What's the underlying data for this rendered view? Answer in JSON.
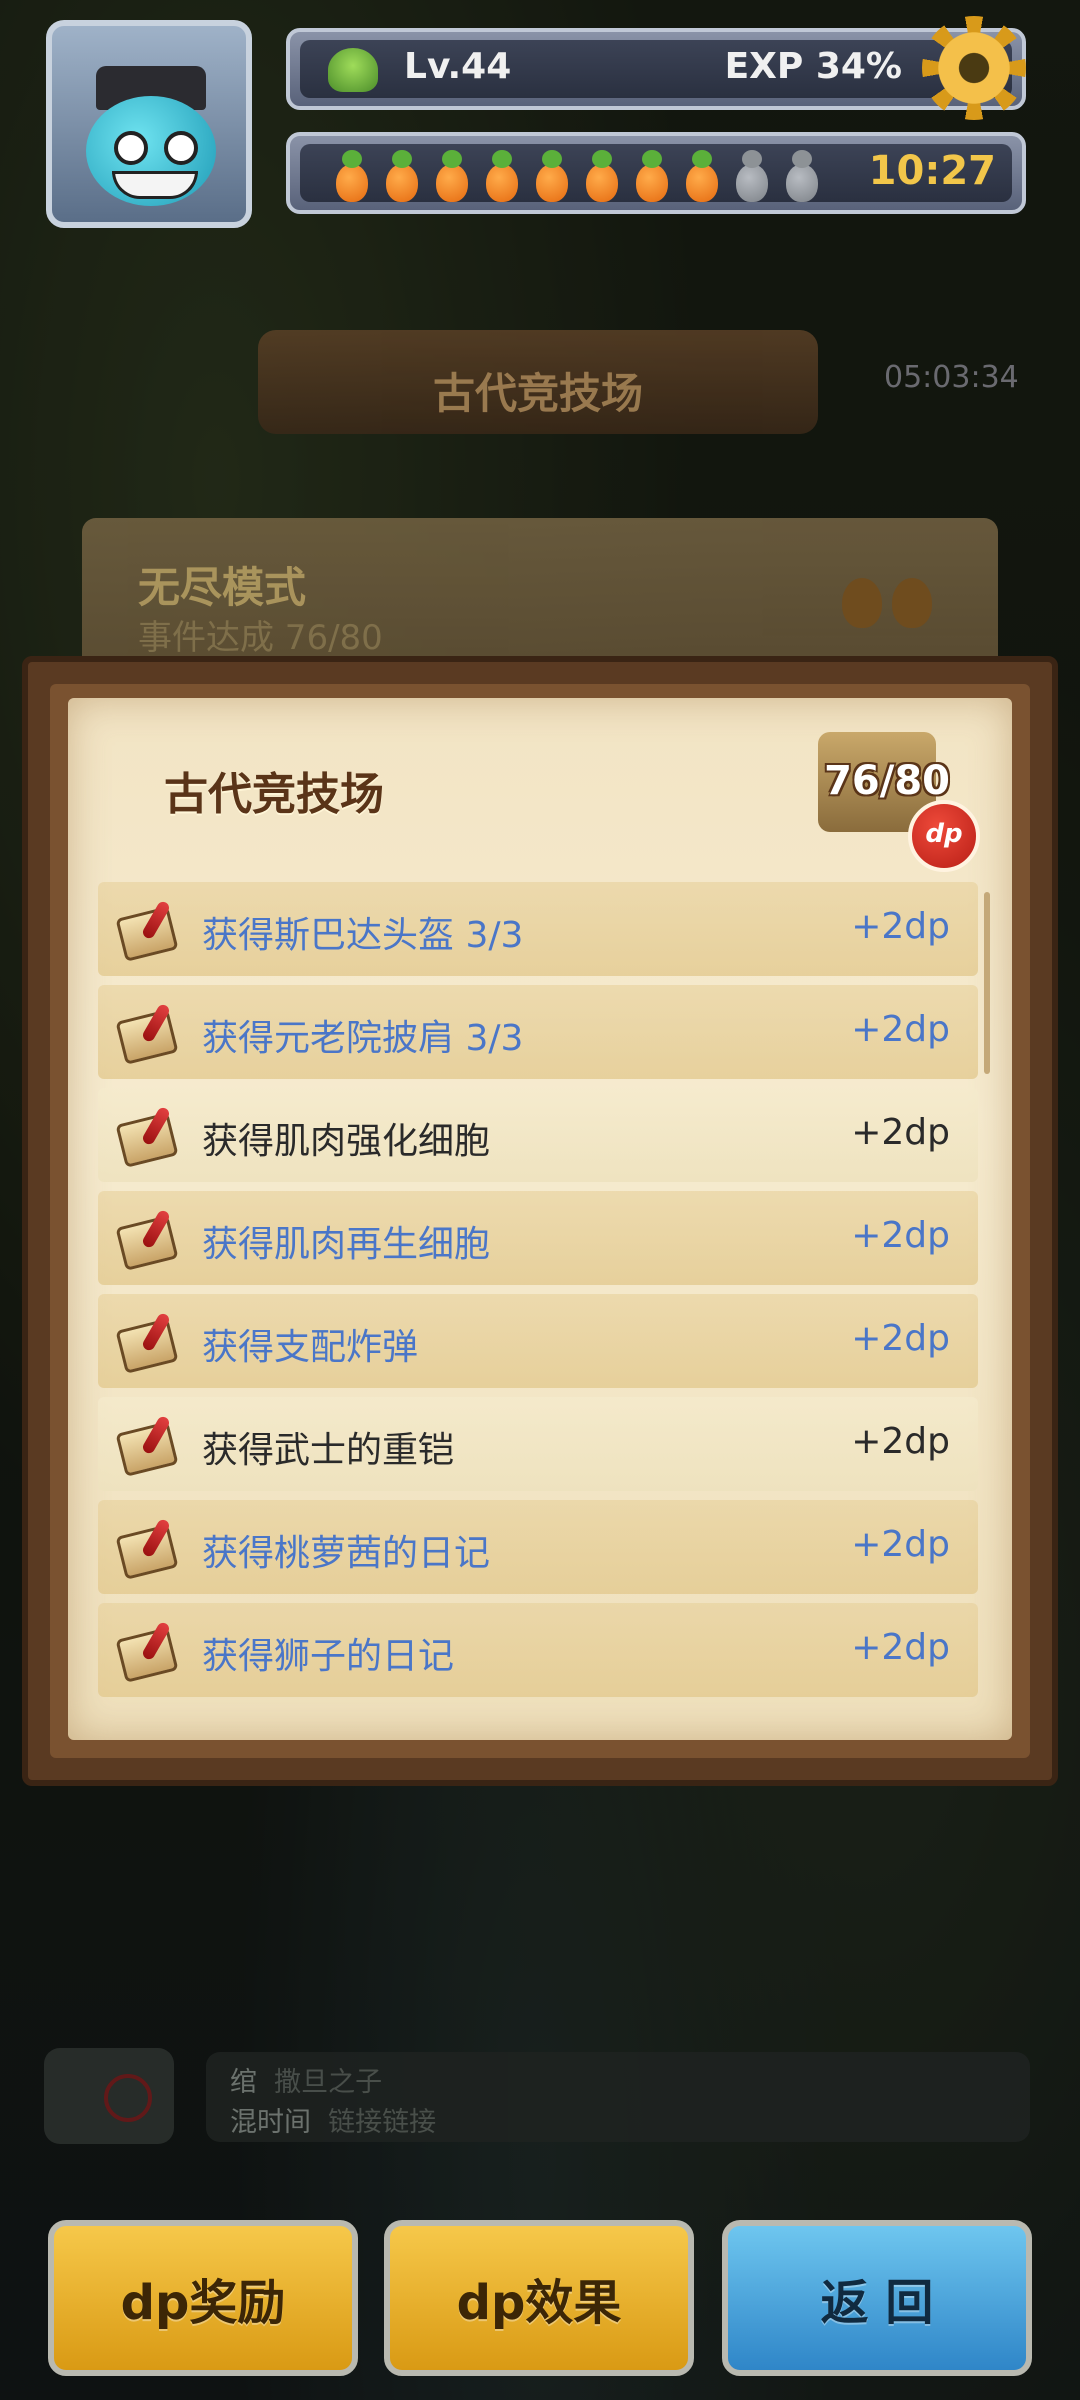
{
  "hud": {
    "level": "Lv.44",
    "exp": "EXP 34%",
    "stamina_full": 8,
    "stamina_total": 10,
    "timer": "10:27"
  },
  "background": {
    "arena_banner": "古代竞技场",
    "countdown": "05:03:34",
    "mode_title": "无尽模式",
    "mode_progress": "事件达成  76/80"
  },
  "panel": {
    "title": "古代竞技场",
    "count": "76/80",
    "badge": "dp",
    "items": [
      {
        "label": "获得斯巴达头盔 3/3",
        "pts": "+2dp",
        "done": false
      },
      {
        "label": "获得元老院披肩 3/3",
        "pts": "+2dp",
        "done": false
      },
      {
        "label": "获得肌肉强化细胞",
        "pts": "+2dp",
        "done": true
      },
      {
        "label": "获得肌肉再生细胞",
        "pts": "+2dp",
        "done": false
      },
      {
        "label": "获得支配炸弹",
        "pts": "+2dp",
        "done": false
      },
      {
        "label": "获得武士的重铠",
        "pts": "+2dp",
        "done": true
      },
      {
        "label": "获得桃萝茜的日记",
        "pts": "+2dp",
        "done": false
      },
      {
        "label": "获得狮子的日记",
        "pts": "+2dp",
        "done": false
      }
    ]
  },
  "chat": {
    "line1_name": "绾",
    "line1_msg": "撒旦之子",
    "line2_name": "混时间",
    "line2_msg": "链接链接"
  },
  "buttons": {
    "reward": "dp奖励",
    "effect": "dp效果",
    "back": "返 回"
  },
  "colors": {
    "incomplete_text": "#4a76c8",
    "complete_text": "#2a2a2a",
    "gold_button": "#f6c84a",
    "blue_button": "#6ec6ef"
  }
}
